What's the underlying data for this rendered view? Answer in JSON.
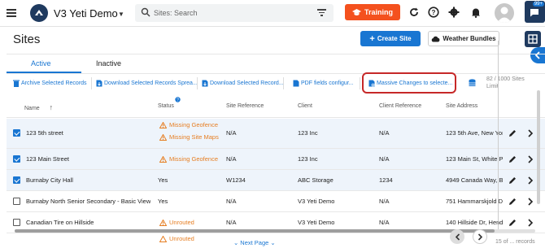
{
  "app": {
    "title": "V3 Yeti Demo",
    "search_placeholder": "Sites: Search",
    "training_label": "Training",
    "notification_badge": "99+"
  },
  "page": {
    "title": "Sites",
    "create_label": "Create Site",
    "weather_label": "Weather Bundles"
  },
  "tabs": [
    {
      "label": "Active",
      "active": true
    },
    {
      "label": "Inactive",
      "active": false
    }
  ],
  "toolbar": {
    "archive": "Archive Selected Records",
    "download_spread": "Download Selected Records Sprea...",
    "download_records": "Download Selected Record...",
    "pdf_fields": "PDF fields configur...",
    "massive": "Massive Changes to selecte...",
    "count_line1": "82 / 1000 Sites",
    "count_line2": "Limit"
  },
  "table": {
    "columns": {
      "name": "Name",
      "status": "Status",
      "site_ref": "Site Reference",
      "client": "Client",
      "client_ref": "Client Reference",
      "address": "Site Address"
    },
    "rows": [
      {
        "selected": true,
        "name": "123 5th street",
        "status1": "Missing Geofence",
        "status2": "Missing Site Maps",
        "site_ref": "N/A",
        "client": "123 Inc",
        "client_ref": "N/A",
        "address": "123 5th Ave, New Yor"
      },
      {
        "selected": true,
        "name": "123 Main Street",
        "status1": "Missing Geofence",
        "site_ref": "N/A",
        "client": "123 Inc",
        "client_ref": "N/A",
        "address": "123 Main St, White Pl"
      },
      {
        "selected": true,
        "name": "Burnaby City Hall",
        "status_text": "Yes",
        "site_ref": "W1234",
        "client": "ABC Storage",
        "client_ref": "1234",
        "address": "4949 Canada Way, Bu"
      },
      {
        "selected": false,
        "name": "Burnaby North Senior Secondary - Basic View",
        "status_text": "Yes",
        "site_ref": "N/A",
        "client": "V3 Yeti Demo",
        "client_ref": "N/A",
        "address": "751 Hammarskjold D"
      },
      {
        "selected": false,
        "name": "Canadian Tire on Hillside",
        "status1": "Unrouted",
        "site_ref": "N/A",
        "client": "V3 Yeti Demo",
        "client_ref": "N/A",
        "address": "140 Hillside Dr, Hend"
      },
      {
        "selected": false,
        "name": "",
        "status1": "Unrouted",
        "site_ref": "",
        "client": "",
        "client_ref": "",
        "address": ""
      }
    ]
  },
  "pager": {
    "next_label": "Next Page",
    "range": "15 of ... records"
  },
  "colors": {
    "primary": "#1976d2",
    "training": "#f4511e",
    "warning": "#e67e22",
    "highlight": "#c62828",
    "navy": "#1f3a5f"
  }
}
